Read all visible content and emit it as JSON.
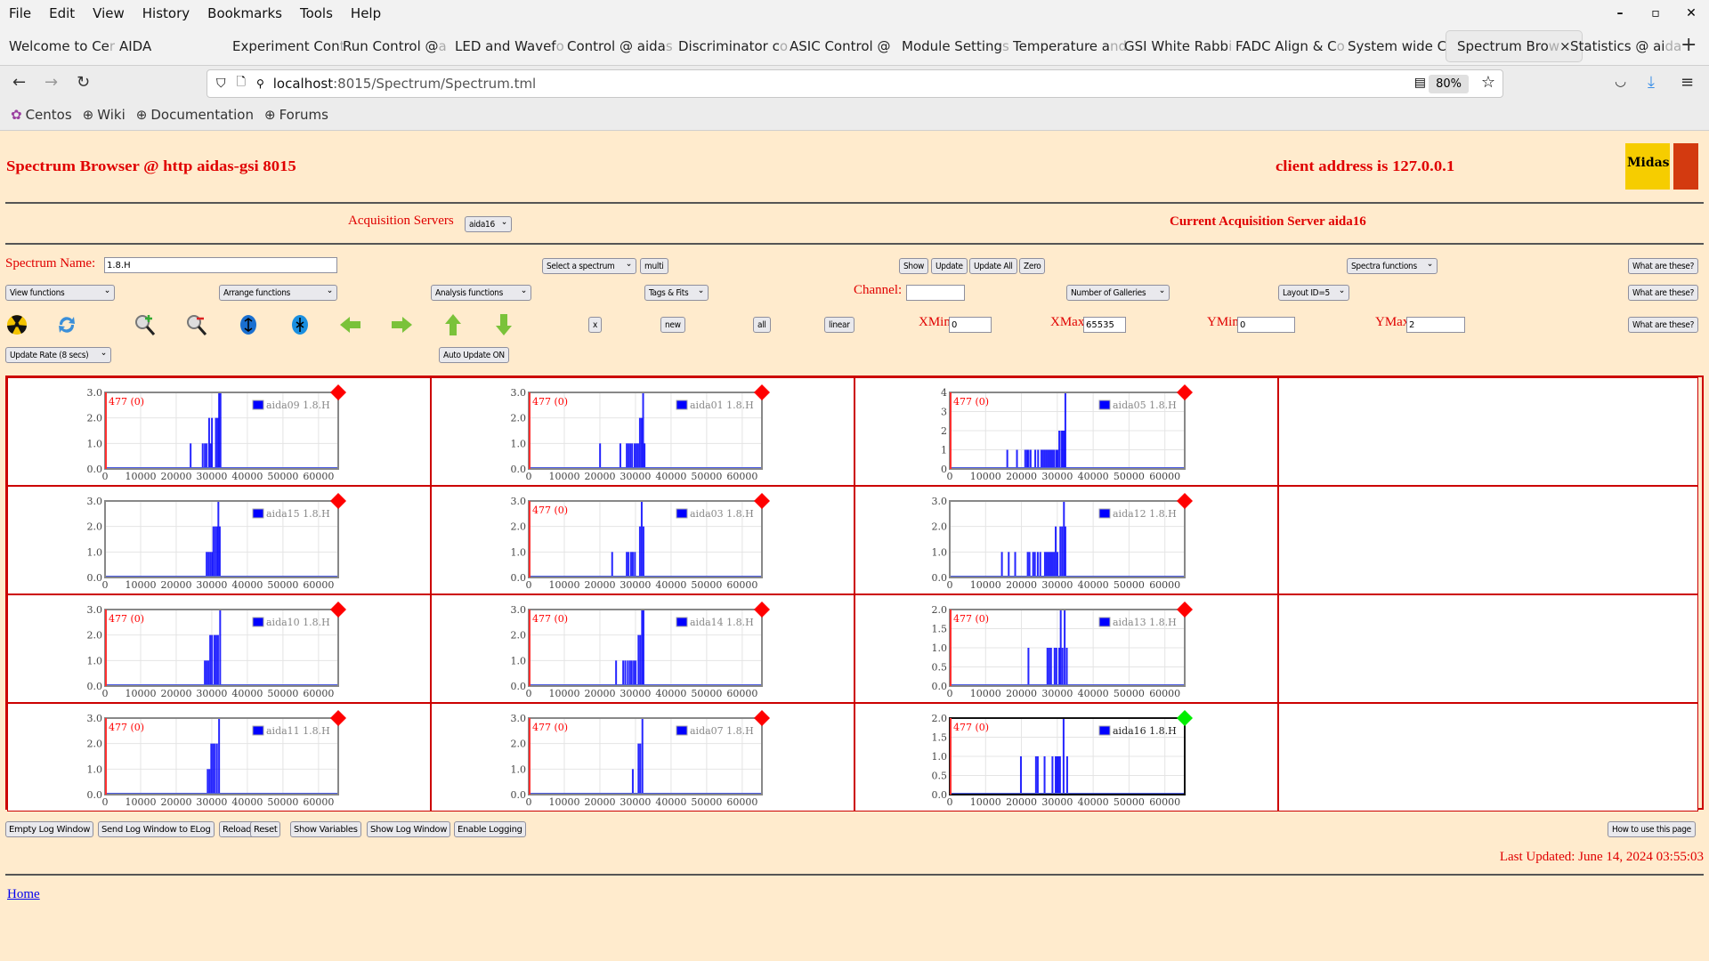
{
  "browser": {
    "menu": [
      "File",
      "Edit",
      "View",
      "History",
      "Bookmarks",
      "Tools",
      "Help"
    ],
    "tabs": [
      {
        "label": "Welcome to Ce",
        "fade": "r"
      },
      {
        "label": "AIDA",
        "fade": ""
      },
      {
        "label": "Experiment Con",
        "fade": "t"
      },
      {
        "label": "Run Control @ ",
        "fade": "a"
      },
      {
        "label": "LED and Wavef",
        "fade": "o"
      },
      {
        "label": "Control @ aida",
        "fade": "s"
      },
      {
        "label": "Discriminator c",
        "fade": "o"
      },
      {
        "label": "ASIC Control @",
        "fade": ""
      },
      {
        "label": "Module Setting",
        "fade": "s"
      },
      {
        "label": "Temperature a",
        "fade": "nd"
      },
      {
        "label": "GSI White Rabb",
        "fade": "i"
      },
      {
        "label": "FADC Align & C",
        "fade": "o"
      },
      {
        "label": "System wide C",
        "fade": "h"
      },
      {
        "label": "Spectrum Bro",
        "fade": "w",
        "active": true
      },
      {
        "label": "Statistics @ ai",
        "fade": "da"
      }
    ],
    "url_host": "localhost",
    "url_path": ":8015/Spectrum/Spectrum.tml",
    "zoom": "80%",
    "bookmarks": [
      "Centos",
      "Wiki",
      "Documentation",
      "Forums"
    ]
  },
  "header": {
    "title": "Spectrum Browser @ http aidas-gsi 8015",
    "client": "client address is 127.0.0.1",
    "logo_text": "Midas"
  },
  "server": {
    "label": "Acquisition Servers",
    "selected": "aida16",
    "current": "Current Acquisition Server aida16"
  },
  "controls": {
    "spectrum_name_label": "Spectrum Name:",
    "spectrum_name_value": "1.8.H",
    "select_spectrum": "Select a spectrum",
    "multi": "multi",
    "show": "Show",
    "update": "Update",
    "update_all": "Update All",
    "zero": "Zero",
    "spectra_functions": "Spectra functions",
    "what": "What are these?",
    "view_functions": "View functions",
    "arrange_functions": "Arrange functions",
    "analysis_functions": "Analysis functions",
    "tags_fits": "Tags & Fits",
    "channel_label": "Channel:",
    "channel_value": "",
    "galleries": "Number of Galleries",
    "layout": "Layout ID=5",
    "x_btn": "x",
    "new_btn": "new",
    "all_btn": "all",
    "linear_btn": "linear",
    "xmin_label": "XMin",
    "xmin": "0",
    "xmax_label": "XMax",
    "xmax": "65535",
    "ymin_label": "YMin",
    "ymin": "0",
    "ymax_label": "YMax",
    "ymax": "2",
    "update_rate": "Update Rate (8 secs)",
    "auto_update": "Auto Update ON"
  },
  "footer": {
    "buttons": [
      "Empty Log Window",
      "Send Log Window to ELog",
      "Reload",
      "Reset",
      "Show Variables",
      "Show Log Window",
      "Enable Logging"
    ],
    "how_to": "How to use this page",
    "last_updated": "Last Updated: June 14, 2024 03:55:03",
    "home": "Home"
  },
  "colors": {
    "accent": "#ff0000",
    "bar": "#0000ff",
    "ok": "#00ff00",
    "bg": "#ffebcd"
  },
  "chart_data": [
    {
      "type": "bar",
      "title": "aida09 1.8.H",
      "legend": "aida09 1.8.H",
      "marker": "477 (0)",
      "status": "red",
      "ylim": [
        0,
        3
      ],
      "yticks": [
        "0.0",
        "1.0",
        "2.0",
        "3.0"
      ],
      "xlim": [
        0,
        65535
      ],
      "xticks": [
        0,
        10000,
        20000,
        30000,
        40000,
        50000,
        60000
      ],
      "bins": [
        [
          23800,
          1
        ],
        [
          27200,
          1
        ],
        [
          27800,
          1
        ],
        [
          28300,
          1
        ],
        [
          29000,
          2
        ],
        [
          29400,
          1
        ],
        [
          29800,
          2
        ],
        [
          30900,
          2
        ],
        [
          31400,
          2
        ],
        [
          31800,
          3
        ],
        [
          32200,
          3
        ]
      ]
    },
    {
      "type": "bar",
      "title": "aida01 1.8.H",
      "legend": "aida01 1.8.H",
      "marker": "477 (0)",
      "status": "red",
      "ylim": [
        0,
        3
      ],
      "yticks": [
        "0.0",
        "1.0",
        "2.0",
        "3.0"
      ],
      "xlim": [
        0,
        65535
      ],
      "xticks": [
        0,
        10000,
        20000,
        30000,
        40000,
        50000,
        60000
      ],
      "bins": [
        [
          19800,
          1
        ],
        [
          25500,
          1
        ],
        [
          27300,
          1
        ],
        [
          27800,
          1
        ],
        [
          28300,
          1
        ],
        [
          28800,
          1
        ],
        [
          29500,
          1
        ],
        [
          30000,
          1
        ],
        [
          30500,
          1
        ],
        [
          31000,
          2
        ],
        [
          31500,
          2
        ],
        [
          31900,
          3
        ],
        [
          32300,
          1
        ]
      ]
    },
    {
      "type": "bar",
      "title": "aida05 1.8.H",
      "legend": "aida05 1.8.H",
      "marker": "477 (0)",
      "status": "red",
      "ylim": [
        0,
        4
      ],
      "yticks": [
        "0",
        "1",
        "2",
        "3",
        "4"
      ],
      "xlim": [
        0,
        65535
      ],
      "xticks": [
        0,
        10000,
        20000,
        30000,
        40000,
        50000,
        60000
      ],
      "bins": [
        [
          15800,
          1
        ],
        [
          18500,
          1
        ],
        [
          20800,
          1
        ],
        [
          21300,
          1
        ],
        [
          21700,
          1
        ],
        [
          22300,
          1
        ],
        [
          23600,
          1
        ],
        [
          24400,
          1
        ],
        [
          25300,
          1
        ],
        [
          25800,
          1
        ],
        [
          26300,
          1
        ],
        [
          26800,
          1
        ],
        [
          27300,
          1
        ],
        [
          27800,
          1
        ],
        [
          28300,
          1
        ],
        [
          28800,
          1
        ],
        [
          29400,
          1
        ],
        [
          29800,
          1
        ],
        [
          30300,
          2
        ],
        [
          30900,
          2
        ],
        [
          31300,
          2
        ],
        [
          31700,
          2
        ],
        [
          32000,
          4
        ]
      ]
    },
    null,
    {
      "type": "bar",
      "title": "aida15 1.8.H",
      "legend": "aida15 1.8.H",
      "marker": "",
      "status": "red",
      "ylim": [
        0,
        3
      ],
      "yticks": [
        "0.0",
        "1.0",
        "2.0",
        "3.0"
      ],
      "xlim": [
        0,
        65535
      ],
      "xticks": [
        0,
        10000,
        20000,
        30000,
        40000,
        50000,
        60000
      ],
      "bins": [
        [
          28300,
          1
        ],
        [
          28800,
          1
        ],
        [
          29300,
          1
        ],
        [
          29800,
          1
        ],
        [
          30200,
          2
        ],
        [
          30700,
          2
        ],
        [
          31200,
          2
        ],
        [
          31600,
          3
        ],
        [
          32000,
          2
        ]
      ]
    },
    {
      "type": "bar",
      "title": "aida03 1.8.H",
      "legend": "aida03 1.8.H",
      "marker": "477 (0)",
      "status": "red",
      "ylim": [
        0,
        3
      ],
      "yticks": [
        "0.0",
        "1.0",
        "2.0",
        "3.0"
      ],
      "xlim": [
        0,
        65535
      ],
      "xticks": [
        0,
        10000,
        20000,
        30000,
        40000,
        50000,
        60000
      ],
      "bins": [
        [
          23200,
          1
        ],
        [
          27300,
          1
        ],
        [
          27800,
          1
        ],
        [
          28500,
          1
        ],
        [
          29000,
          1
        ],
        [
          29600,
          1
        ],
        [
          31000,
          2
        ],
        [
          31500,
          3
        ],
        [
          32000,
          2
        ]
      ]
    },
    {
      "type": "bar",
      "title": "aida12 1.8.H",
      "legend": "aida12 1.8.H",
      "marker": "",
      "status": "red",
      "ylim": [
        0,
        3
      ],
      "yticks": [
        "0.0",
        "1.0",
        "2.0",
        "3.0"
      ],
      "xlim": [
        0,
        65535
      ],
      "xticks": [
        0,
        10000,
        20000,
        30000,
        40000,
        50000,
        60000
      ],
      "bins": [
        [
          14300,
          1
        ],
        [
          16200,
          1
        ],
        [
          18000,
          1
        ],
        [
          21500,
          1
        ],
        [
          22000,
          1
        ],
        [
          23000,
          1
        ],
        [
          23500,
          1
        ],
        [
          24300,
          1
        ],
        [
          25000,
          1
        ],
        [
          26300,
          1
        ],
        [
          26800,
          1
        ],
        [
          27300,
          1
        ],
        [
          27800,
          1
        ],
        [
          28300,
          1
        ],
        [
          28800,
          1
        ],
        [
          29300,
          2
        ],
        [
          29800,
          1
        ],
        [
          30600,
          2
        ],
        [
          31100,
          2
        ],
        [
          31600,
          3
        ],
        [
          32000,
          2
        ]
      ]
    },
    null,
    {
      "type": "bar",
      "title": "aida10 1.8.H",
      "legend": "aida10 1.8.H",
      "marker": "477 (0)",
      "status": "red",
      "ylim": [
        0,
        3
      ],
      "yticks": [
        "0.0",
        "1.0",
        "2.0",
        "3.0"
      ],
      "xlim": [
        0,
        65535
      ],
      "xticks": [
        0,
        10000,
        20000,
        30000,
        40000,
        50000,
        60000
      ],
      "bins": [
        [
          27800,
          1
        ],
        [
          28300,
          1
        ],
        [
          28800,
          1
        ],
        [
          29300,
          2
        ],
        [
          29800,
          2
        ],
        [
          30500,
          2
        ],
        [
          31000,
          2
        ],
        [
          31500,
          2
        ],
        [
          32100,
          3
        ]
      ]
    },
    {
      "type": "bar",
      "title": "aida14 1.8.H",
      "legend": "aida14 1.8.H",
      "marker": "477 (0)",
      "status": "red",
      "ylim": [
        0,
        3
      ],
      "yticks": [
        "0.0",
        "1.0",
        "2.0",
        "3.0"
      ],
      "xlim": [
        0,
        65535
      ],
      "xticks": [
        0,
        10000,
        20000,
        30000,
        40000,
        50000,
        60000
      ],
      "bins": [
        [
          24300,
          1
        ],
        [
          26300,
          1
        ],
        [
          26900,
          1
        ],
        [
          27600,
          1
        ],
        [
          28200,
          1
        ],
        [
          28700,
          1
        ],
        [
          29300,
          1
        ],
        [
          29800,
          1
        ],
        [
          30600,
          2
        ],
        [
          31100,
          2
        ],
        [
          31600,
          3
        ],
        [
          32000,
          3
        ]
      ]
    },
    {
      "type": "bar",
      "title": "aida13 1.8.H",
      "legend": "aida13 1.8.H",
      "marker": "477 (0)",
      "status": "red",
      "ylim": [
        0,
        2
      ],
      "yticks": [
        "0.0",
        "0.5",
        "1.0",
        "1.5",
        "2.0"
      ],
      "xlim": [
        0,
        65535
      ],
      "xticks": [
        0,
        10000,
        20000,
        30000,
        40000,
        50000,
        60000
      ],
      "bins": [
        [
          21700,
          1
        ],
        [
          27000,
          1
        ],
        [
          27500,
          1
        ],
        [
          28000,
          1
        ],
        [
          29000,
          1
        ],
        [
          29500,
          1
        ],
        [
          30300,
          1
        ],
        [
          30700,
          2
        ],
        [
          31200,
          1
        ],
        [
          31800,
          2
        ],
        [
          32400,
          1
        ]
      ]
    },
    null,
    {
      "type": "bar",
      "title": "aida11 1.8.H",
      "legend": "aida11 1.8.H",
      "marker": "477 (0)",
      "status": "red",
      "ylim": [
        0,
        3
      ],
      "yticks": [
        "0.0",
        "1.0",
        "2.0",
        "3.0"
      ],
      "xlim": [
        0,
        65535
      ],
      "xticks": [
        0,
        10000,
        20000,
        30000,
        40000,
        50000,
        60000
      ],
      "bins": [
        [
          28600,
          1
        ],
        [
          29100,
          1
        ],
        [
          29600,
          2
        ],
        [
          30100,
          2
        ],
        [
          30600,
          2
        ],
        [
          31200,
          2
        ],
        [
          31800,
          3
        ]
      ]
    },
    {
      "type": "bar",
      "title": "aida07 1.8.H",
      "legend": "aida07 1.8.H",
      "marker": "477 (0)",
      "status": "red",
      "ylim": [
        0,
        3
      ],
      "yticks": [
        "0.0",
        "1.0",
        "2.0",
        "3.0"
      ],
      "xlim": [
        0,
        65535
      ],
      "xticks": [
        0,
        10000,
        20000,
        30000,
        40000,
        50000,
        60000
      ],
      "bins": [
        [
          29000,
          1
        ],
        [
          30600,
          2
        ],
        [
          31100,
          2
        ],
        [
          31700,
          3
        ]
      ]
    },
    {
      "type": "bar",
      "title": "aida16 1.8.H",
      "legend": "aida16 1.8.H",
      "marker": "477 (0)",
      "status": "green",
      "selected": true,
      "ylim": [
        0,
        2
      ],
      "yticks": [
        "0.0",
        "0.5",
        "1.0",
        "1.5",
        "2.0"
      ],
      "xlim": [
        0,
        65535
      ],
      "xticks": [
        0,
        10000,
        20000,
        30000,
        40000,
        50000,
        60000
      ],
      "bins": [
        [
          19600,
          1
        ],
        [
          23800,
          1
        ],
        [
          24300,
          1
        ],
        [
          26200,
          1
        ],
        [
          28400,
          1
        ],
        [
          29300,
          1
        ],
        [
          29700,
          1
        ],
        [
          30100,
          1
        ],
        [
          30500,
          1
        ],
        [
          31500,
          2
        ],
        [
          32500,
          1
        ]
      ]
    },
    null
  ]
}
